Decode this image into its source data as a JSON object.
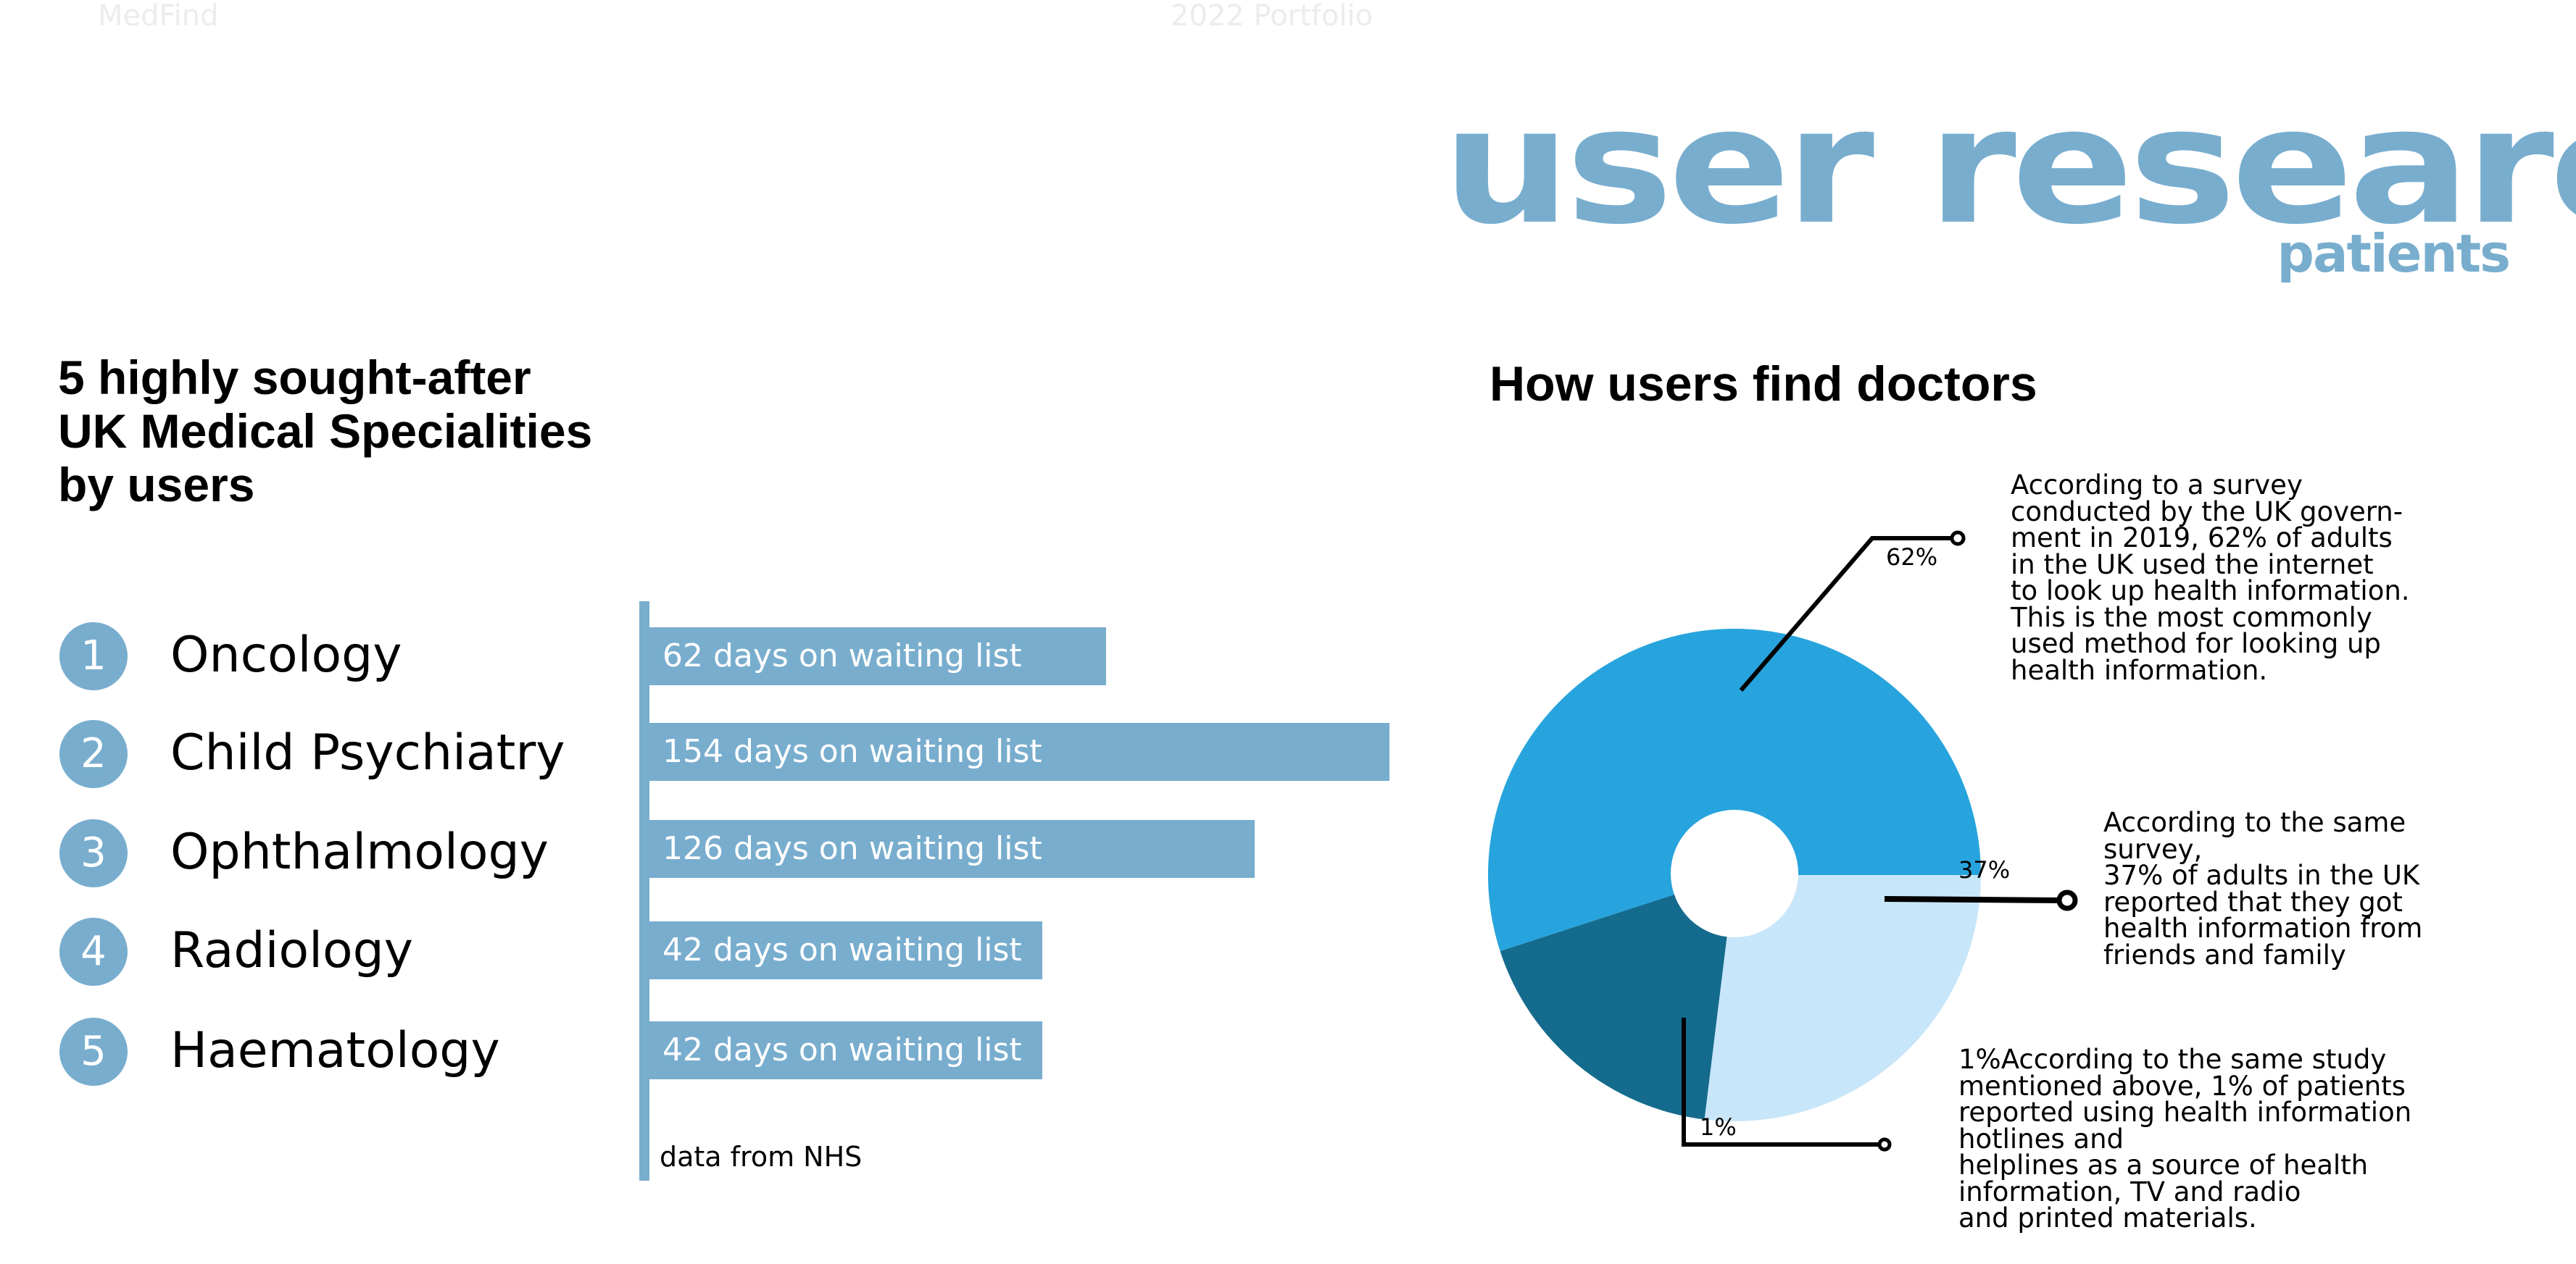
{
  "header": {
    "brand": "MedFind",
    "portfolio": "2022 Portfolio"
  },
  "title": {
    "main": "user research",
    "sub": "patients"
  },
  "colors": {
    "accent": "#78ADCE",
    "pie_internet": "#27A4DD",
    "pie_friends": "#C8E6F9",
    "pie_hotlines": "#146B8D",
    "text": "#000000",
    "faint": "#ECECEC"
  },
  "specialities": {
    "heading_lines": [
      "5 highly sought-after",
      "UK Medical Specialities",
      "by users"
    ],
    "source": "data from NHS"
  },
  "doctors": {
    "heading": "How users find doctors"
  },
  "chart_data": [
    {
      "type": "bar",
      "orientation": "horizontal",
      "title": "5 highly sought-after UK Medical Specialities by users",
      "categories": [
        "Oncology",
        "Child Psychiatry",
        "Ophthalmology",
        "Radiology",
        "Haematology"
      ],
      "ranks": [
        "1",
        "2",
        "3",
        "4",
        "5"
      ],
      "values": [
        62,
        154,
        126,
        42,
        42
      ],
      "units": "days on waiting list",
      "labels": [
        "62 days on waiting list",
        "154 days on waiting list",
        "126 days on waiting list",
        "42 days on waiting list",
        "42 days on waiting list"
      ],
      "xlim": [
        0,
        154
      ],
      "xlabel": "",
      "ylabel": "",
      "grid": false,
      "annotation": "data from NHS"
    },
    {
      "type": "pie",
      "donut": true,
      "title": "How users find doctors",
      "slices": [
        {
          "name": "internet",
          "value": 62,
          "label": "62%",
          "note_lines": [
            "According to a survey",
            "conducted by the UK govern-",
            "ment in 2019, 62% of adults",
            "in the UK used the internet",
            "to look up health information.",
            "This is the most commonly",
            "used method for looking up",
            "health information."
          ]
        },
        {
          "name": "friends and family",
          "value": 37,
          "label": "37%",
          "note_lines": [
            "According to the same",
            "survey,",
            "37% of adults in the UK",
            "reported that they got",
            "health information from",
            "friends and family"
          ]
        },
        {
          "name": "hotlines, helplines, TV, radio and printed materials",
          "value": 1,
          "label": "1%",
          "note_lines": [
            "1%According to the same study",
            "mentioned above, 1% of patients",
            "reported using health information",
            "hotlines and",
            "helplines as a source of health",
            "information, TV and radio",
            "and printed materials."
          ]
        }
      ],
      "legend": "none"
    }
  ]
}
